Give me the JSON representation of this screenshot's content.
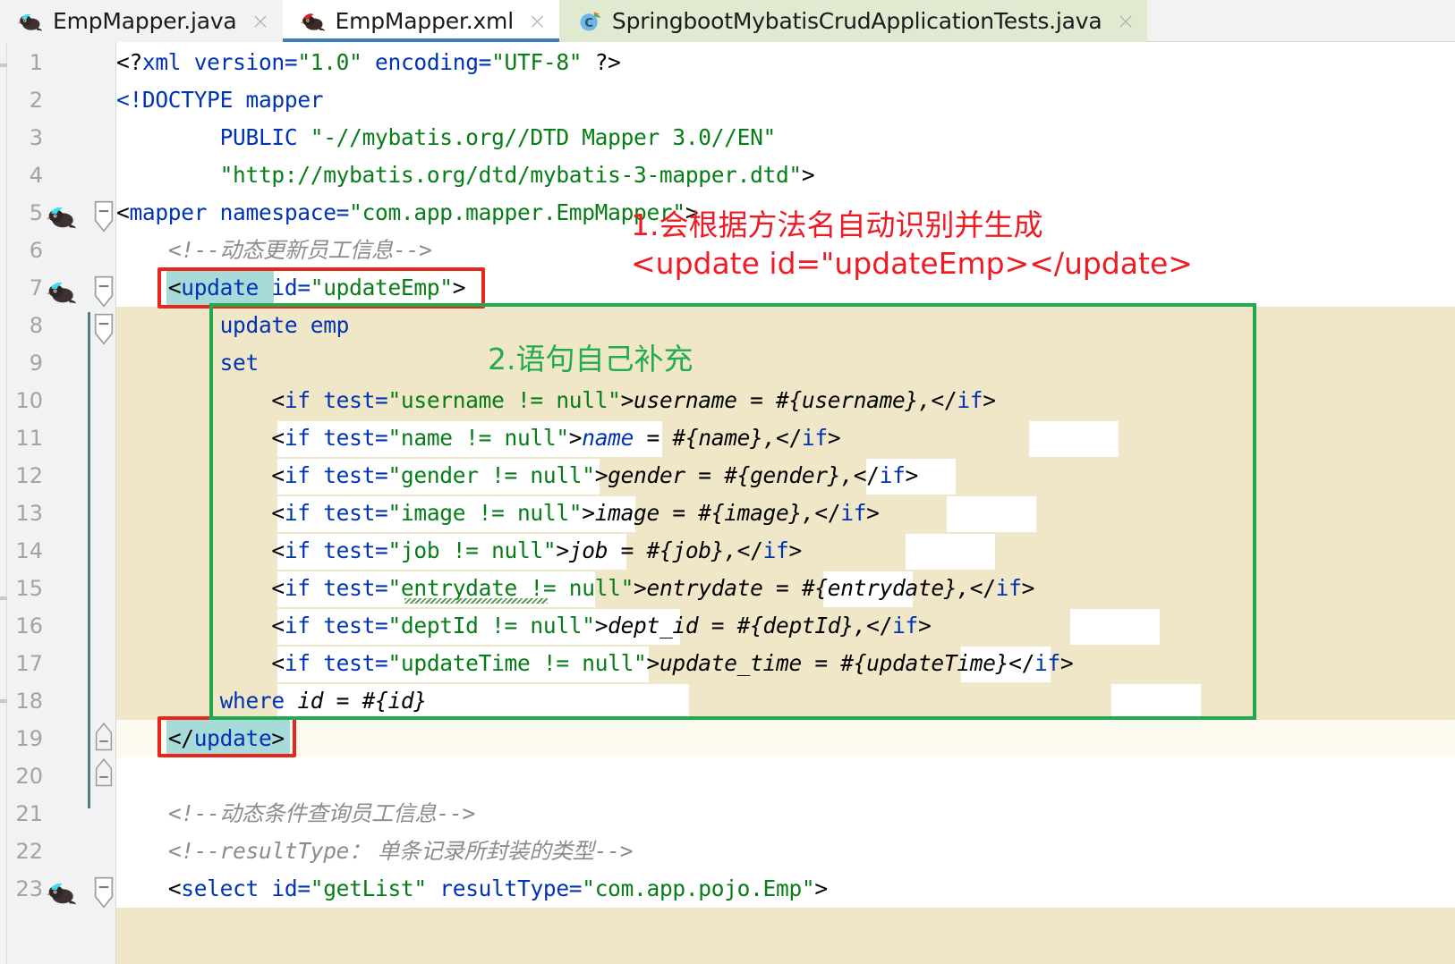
{
  "window": {
    "title": "EmpMapper.xml"
  },
  "tabs": [
    {
      "label": "EmpMapper.java",
      "icon": "mybatis-bird-icon",
      "close": "×",
      "active": false,
      "state": "normal"
    },
    {
      "label": "EmpMapper.xml",
      "icon": "mybatis-bird-red-icon",
      "close": "×",
      "active": true,
      "state": "selected"
    },
    {
      "label": "SpringbootMybatisCrudApplicationTests.java",
      "icon": "spring-test-class-icon",
      "close": "×",
      "active": false,
      "state": "highlighted"
    }
  ],
  "editor": {
    "language": "xml",
    "line_numbers": [
      "1",
      "2",
      "3",
      "4",
      "5",
      "6",
      "7",
      "8",
      "9",
      "10",
      "11",
      "12",
      "13",
      "14",
      "15",
      "16",
      "17",
      "18",
      "19",
      "20",
      "21",
      "22",
      "23"
    ],
    "caret_line": "19",
    "gutter_icons": [
      {
        "line": "5",
        "icon": "mybatis-bird-icon"
      },
      {
        "line": "7",
        "icon": "mybatis-bird-icon"
      },
      {
        "line": "19",
        "icon": "lightbulb-icon"
      },
      {
        "line": "23",
        "icon": "mybatis-bird-icon"
      }
    ],
    "fold_lines": [
      "5",
      "7",
      "8",
      "18",
      "19",
      "23"
    ],
    "lines": [
      {
        "n": "1",
        "text": "<?xml version=\"1.0\" encoding=\"UTF-8\" ?>"
      },
      {
        "n": "2",
        "text": "<!DOCTYPE mapper"
      },
      {
        "n": "3",
        "text": "        PUBLIC \"-//mybatis.org//DTD Mapper 3.0//EN\""
      },
      {
        "n": "4",
        "text": "        \"http://mybatis.org/dtd/mybatis-3-mapper.dtd\">"
      },
      {
        "n": "5",
        "text": "<mapper namespace=\"com.app.mapper.EmpMapper\">"
      },
      {
        "n": "6",
        "text": "    <!--动态更新员工信息-->"
      },
      {
        "n": "7",
        "text": "    <update id=\"updateEmp\">"
      },
      {
        "n": "8",
        "text": "        update emp"
      },
      {
        "n": "9",
        "text": "        set"
      },
      {
        "n": "10",
        "text": "            <if test=\"username != null\">username = #{username},</if>"
      },
      {
        "n": "11",
        "text": "            <if test=\"name != null\">name = #{name},</if>"
      },
      {
        "n": "12",
        "text": "            <if test=\"gender != null\">gender = #{gender},</if>"
      },
      {
        "n": "13",
        "text": "            <if test=\"image != null\">image = #{image},</if>"
      },
      {
        "n": "14",
        "text": "            <if test=\"job != null\">job = #{job},</if>"
      },
      {
        "n": "15",
        "text": "            <if test=\"entrydate != null\">entrydate = #{entrydate},</if>"
      },
      {
        "n": "16",
        "text": "            <if test=\"deptId != null\">dept_id = #{deptId},</if>"
      },
      {
        "n": "17",
        "text": "            <if test=\"updateTime != null\">update_time = #{updateTime}</if>"
      },
      {
        "n": "18",
        "text": "        where id = #{id}"
      },
      {
        "n": "19",
        "text": "    </update>"
      },
      {
        "n": "20",
        "text": ""
      },
      {
        "n": "21",
        "text": "    <!--动态条件查询员工信息-->"
      },
      {
        "n": "22",
        "text": "    <!--resultType： 单条记录所封装的类型-->"
      },
      {
        "n": "23",
        "text": "    <select id=\"getList\" resultType=\"com.app.pojo.Emp\">"
      }
    ],
    "spellcheck_words": [
      "entrydate"
    ]
  },
  "annotations": [
    {
      "id": "note-1",
      "color": "#ee1b24",
      "line1": "1.会根据方法名自动识别并生成",
      "line2": "<update id=\"updateEmp></update>"
    },
    {
      "id": "note-2",
      "color": "#23ab4f",
      "line1": "2.语句自己补充"
    }
  ],
  "highlight_boxes": [
    {
      "id": "redbox-open-update",
      "color": "#e8271c",
      "target": "<update id=\"updateEmp\">"
    },
    {
      "id": "redbox-close-update",
      "color": "#e8271c",
      "target": "</update>"
    },
    {
      "id": "greenbox-statement",
      "color": "#1faa4e",
      "target": "update emp ... where id = #{id}"
    }
  ],
  "colors": {
    "tab_active_underline": "#3d7fbf",
    "tab_green_bg": "#dfead0",
    "gutter_bg": "#f1f2f3",
    "scope_beige": "#efe7c8",
    "caret_line_bg": "#fdfbf0",
    "selection_teal": "#a8dada",
    "annotation_red": "#ee1b24",
    "annotation_green": "#23ab4f",
    "xml_tag": "#0033b3",
    "xml_string": "#067d17",
    "comment_gray": "#8c8c8c"
  }
}
